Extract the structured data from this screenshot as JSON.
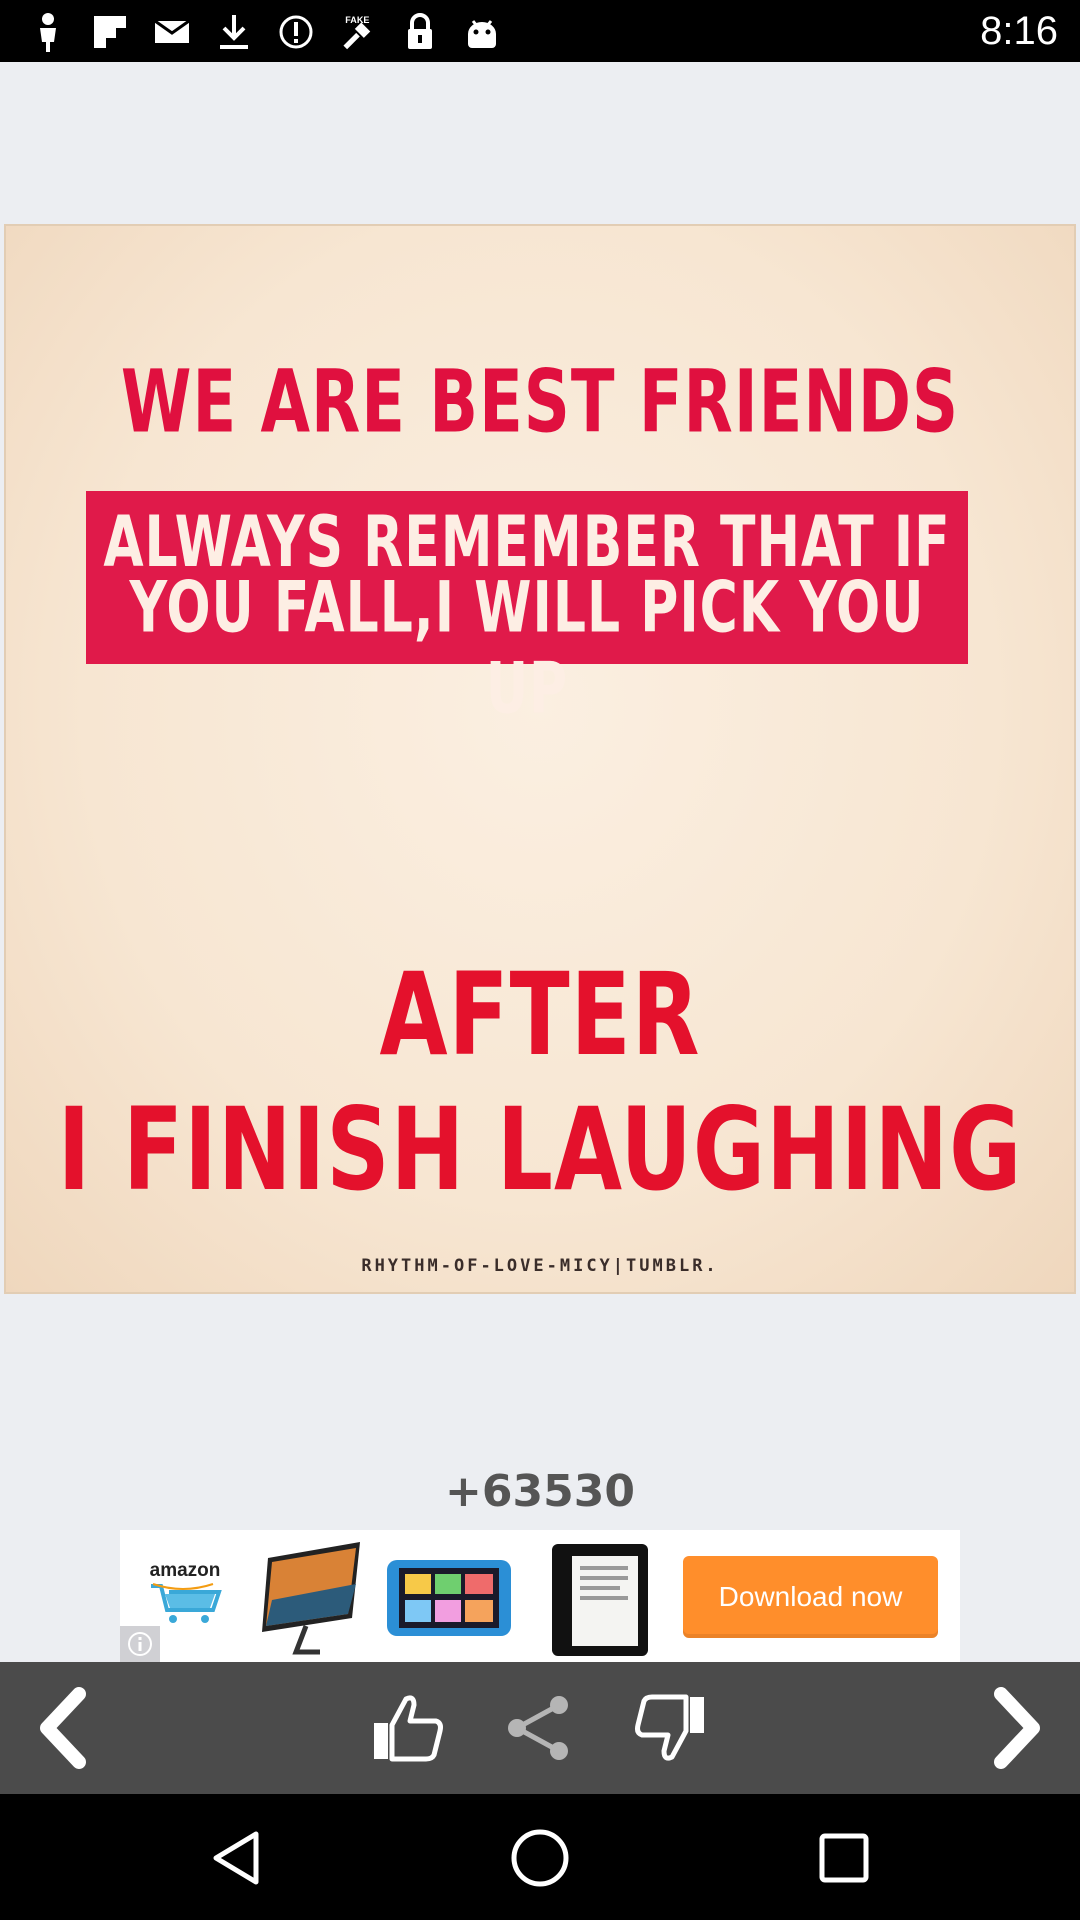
{
  "status_bar": {
    "time": "8:16",
    "icons": [
      "person-icon",
      "flipboard-icon",
      "mail-icon",
      "download-icon",
      "alert-icon",
      "fake-gps-icon",
      "lock-icon",
      "android-icon"
    ],
    "fake_label": "FAKE"
  },
  "poster": {
    "line1": "WE ARE BEST FRIENDS",
    "block_line1": "ALWAYS REMEMBER THAT IF",
    "block_line2": "YOU FALL,I WILL PICK YOU UP",
    "line_after": "AFTER",
    "line_finish": "I FINISH LAUGHING",
    "credit": "RHYTHM-OF-LOVE-MICY|TUMBLR."
  },
  "likes": {
    "count": "+63530"
  },
  "ad": {
    "brand": "amazon",
    "button_label": "Download now"
  },
  "toolbar": {
    "icons": [
      "back-arrow-icon",
      "thumbs-up-icon",
      "share-icon",
      "thumbs-down-icon",
      "forward-arrow-icon"
    ]
  },
  "colors": {
    "accent_red": "#e01a4a",
    "ad_button": "#ff8e2b",
    "toolbar_bg": "#4b4b4b"
  }
}
